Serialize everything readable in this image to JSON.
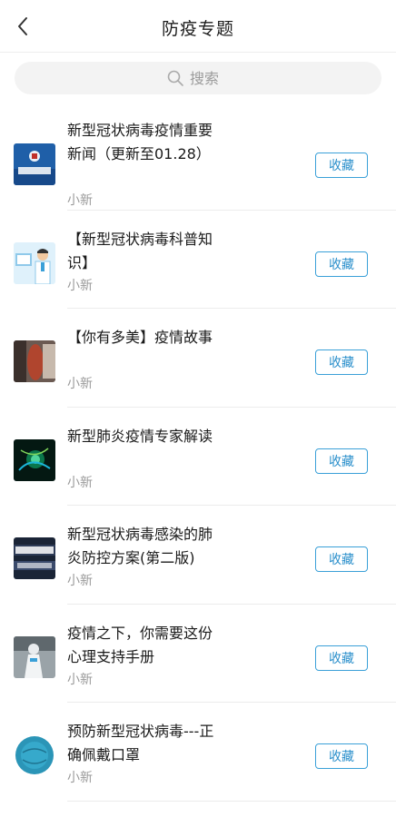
{
  "header": {
    "title": "防疫专题",
    "back_icon": "chevron-left-icon"
  },
  "search": {
    "placeholder": "搜索",
    "icon": "search-icon"
  },
  "colors": {
    "accent": "#2a8fcb",
    "divider": "#ececec",
    "search_bg": "#f3f3f3"
  },
  "items": [
    {
      "title": "新型冠状病毒疫情重要新闻（更新至01.28）",
      "source": "小新",
      "button": "收藏",
      "thumb": "news-thumbnail"
    },
    {
      "title": "【新型冠状病毒科普知识】",
      "source": "小新",
      "button": "收藏",
      "thumb": "doctor-illustration-thumbnail"
    },
    {
      "title": "【你有多美】疫情故事",
      "source": "小新",
      "button": "收藏",
      "thumb": "photo-thumbnail"
    },
    {
      "title": "新型肺炎疫情专家解读",
      "source": "小新",
      "button": "收藏",
      "thumb": "virus-image-thumbnail"
    },
    {
      "title": "新型冠状病毒感染的肺炎防控方案(第二版)",
      "source": "小新",
      "button": "收藏",
      "thumb": "prevention-plan-thumbnail"
    },
    {
      "title": "疫情之下，你需要这份心理支持手册",
      "source": "小新",
      "button": "收藏",
      "thumb": "protective-suit-thumbnail"
    },
    {
      "title": "预防新型冠状病毒---正确佩戴口罩",
      "source": "小新",
      "button": "收藏",
      "thumb": "mask-thumbnail"
    }
  ]
}
